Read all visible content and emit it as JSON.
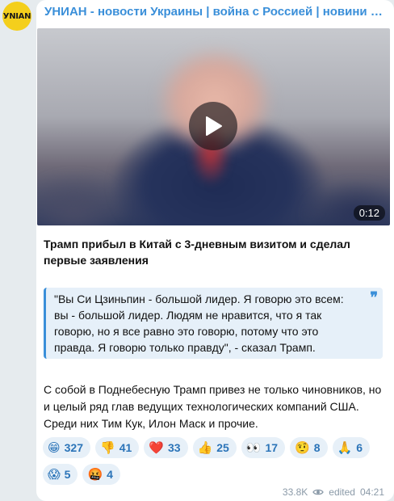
{
  "channel": {
    "title": "УНИАН - новости Украины | война с Россией | новини Україні...",
    "avatar_text": "УNIAN"
  },
  "video": {
    "duration": "0:12",
    "play_icon": "play-icon"
  },
  "post": {
    "headline": "Трамп прибыл в Китай с 3-дневным визитом и сделал первые заявления",
    "quote": "\"Вы Си Цзиньпин - большой лидер. Я говорю это всем: вы - большой лидер. Людям не нравится, что я так говорю, но я все равно это говорю, потому что это правда. Я говорю только правду\", - сказал Трамп.",
    "quote_mark": "❞",
    "body": "С собой в Поднебесную Трамп привез не только чиновников, но и целый ряд глав ведущих технологических компаний США. Среди них Тим Кук, Илон Маск и прочие."
  },
  "reactions": [
    {
      "emoji": "😁",
      "count": "327",
      "icon": "grin-icon"
    },
    {
      "emoji": "👎",
      "count": "41",
      "icon": "thumbs-down-icon"
    },
    {
      "emoji": "❤️",
      "count": "33",
      "icon": "heart-icon"
    },
    {
      "emoji": "👍",
      "count": "25",
      "icon": "thumbs-up-icon"
    },
    {
      "emoji": "👀",
      "count": "17",
      "icon": "eyes-icon"
    },
    {
      "emoji": "🤨",
      "count": "8",
      "icon": "raised-eyebrow-icon"
    },
    {
      "emoji": "🙏",
      "count": "6",
      "icon": "pray-icon"
    },
    {
      "emoji": "😱",
      "count": "5",
      "icon": "scream-icon"
    },
    {
      "emoji": "🤬",
      "count": "4",
      "icon": "cursing-face-icon"
    }
  ],
  "meta": {
    "views": "33.8K",
    "edited_label": "edited",
    "time": "04:21",
    "views_icon": "eye-icon"
  },
  "colors": {
    "accent": "#3a8fd9",
    "chip_bg": "#e7f0f8",
    "quote_bg": "#e6f0f9",
    "avatar_bg": "#f4cf1c"
  }
}
